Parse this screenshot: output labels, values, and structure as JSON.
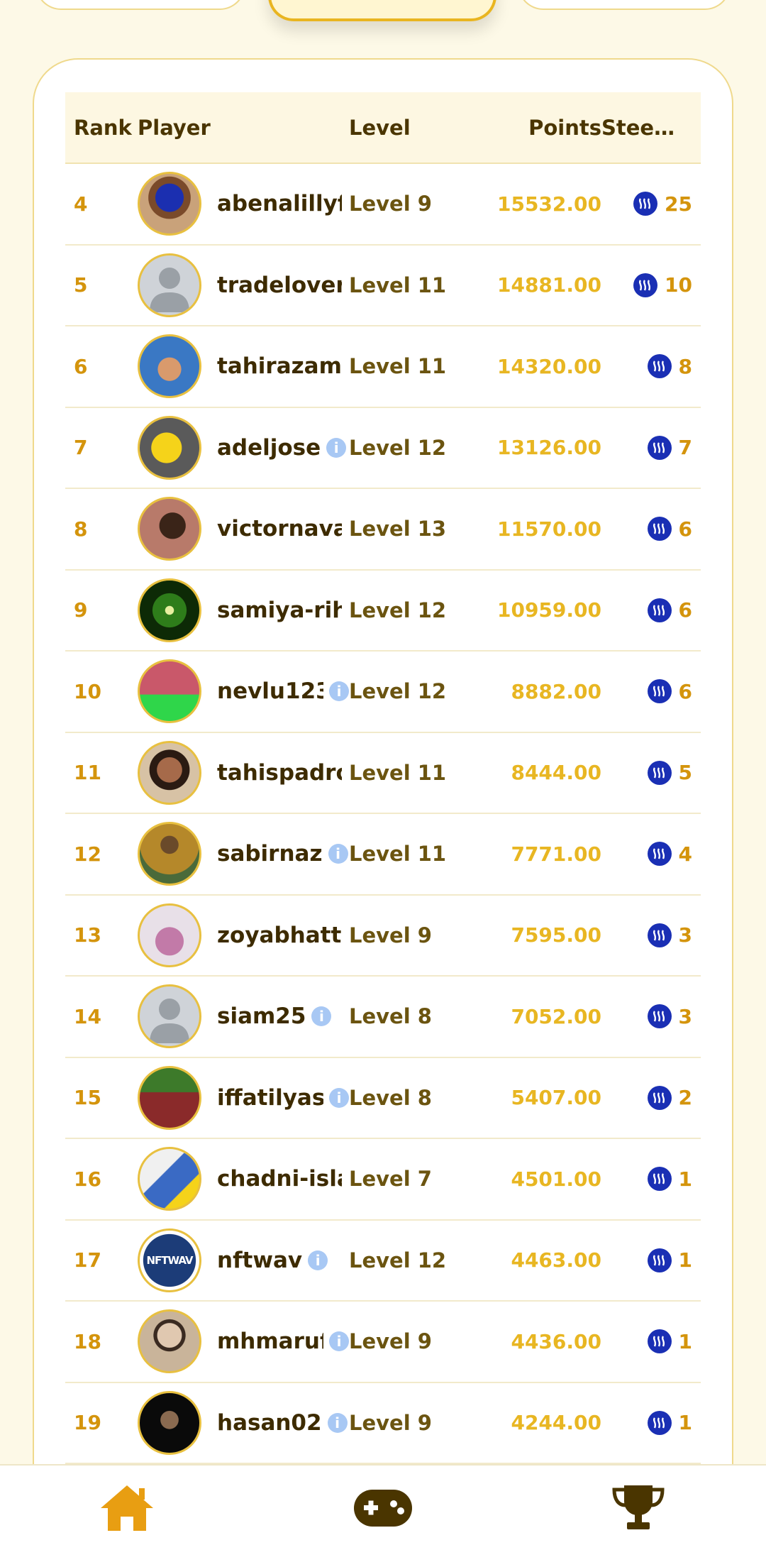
{
  "table": {
    "headers": {
      "rank": "Rank",
      "player": "Player",
      "level": "Level",
      "points": "Points",
      "steem": "Steem R..."
    },
    "rows": [
      {
        "rank": "4",
        "name": "abenalillyf",
        "info": false,
        "level": "Level 9",
        "points": "15532.00",
        "steem": "25",
        "avatar": "photo-blue-dress"
      },
      {
        "rank": "5",
        "name": "tradelover",
        "info": false,
        "level": "Level 11",
        "points": "14881.00",
        "steem": "10",
        "avatar": "default-avatar"
      },
      {
        "rank": "6",
        "name": "tahirazam",
        "info": false,
        "level": "Level 11",
        "points": "14320.00",
        "steem": "8",
        "avatar": "photo-child"
      },
      {
        "rank": "7",
        "name": "adeljose",
        "info": true,
        "level": "Level 12",
        "points": "13126.00",
        "steem": "7",
        "avatar": "cartoon-chick"
      },
      {
        "rank": "8",
        "name": "victornava",
        "info": false,
        "level": "Level 13",
        "points": "11570.00",
        "steem": "6",
        "avatar": "photo-dark"
      },
      {
        "rank": "9",
        "name": "samiya-rih",
        "info": false,
        "level": "Level 12",
        "points": "10959.00",
        "steem": "6",
        "avatar": "green-leaves"
      },
      {
        "rank": "10",
        "name": "nevlu123",
        "info": true,
        "level": "Level 12",
        "points": "8882.00",
        "steem": "6",
        "avatar": "photo-green"
      },
      {
        "rank": "11",
        "name": "tahispadro",
        "info": false,
        "level": "Level 11",
        "points": "8444.00",
        "steem": "5",
        "avatar": "photo-girl"
      },
      {
        "rank": "12",
        "name": "sabirnaz",
        "info": true,
        "level": "Level 11",
        "points": "7771.00",
        "steem": "4",
        "avatar": "photo-man"
      },
      {
        "rank": "13",
        "name": "zoyabhatti",
        "info": false,
        "level": "Level 9",
        "points": "7595.00",
        "steem": "3",
        "avatar": "photo-pink"
      },
      {
        "rank": "14",
        "name": "siam25",
        "info": true,
        "level": "Level 8",
        "points": "7052.00",
        "steem": "3",
        "avatar": "default-avatar"
      },
      {
        "rank": "15",
        "name": "iffatilyas",
        "info": true,
        "level": "Level 8",
        "points": "5407.00",
        "steem": "2",
        "avatar": "photo-outdoor"
      },
      {
        "rank": "16",
        "name": "chadni-isla",
        "info": false,
        "level": "Level 7",
        "points": "4501.00",
        "steem": "1",
        "avatar": "photo-family"
      },
      {
        "rank": "17",
        "name": "nftwav",
        "info": true,
        "level": "Level 12",
        "points": "4463.00",
        "steem": "1",
        "avatar": "nftwav-logo",
        "avatar_text": "NFTWAV"
      },
      {
        "rank": "18",
        "name": "mhmaruf",
        "info": true,
        "level": "Level 9",
        "points": "4436.00",
        "steem": "1",
        "avatar": "photo-man-2"
      },
      {
        "rank": "19",
        "name": "hasan02",
        "info": true,
        "level": "Level 9",
        "points": "4244.00",
        "steem": "1",
        "avatar": "photo-dark-2"
      }
    ]
  },
  "nav": {
    "items": [
      {
        "name": "home",
        "icon": "home-icon",
        "color": "#e89e12"
      },
      {
        "name": "games",
        "icon": "gamepad-icon",
        "color": "#4a3500"
      },
      {
        "name": "leaderboard",
        "icon": "trophy-icon",
        "color": "#4a3500"
      }
    ]
  },
  "colors": {
    "background": "#fdf9e7",
    "accent": "#e8b622",
    "rank": "#d4940c",
    "text_dark": "#3d2b00",
    "steem_blue": "#1a2fb4",
    "info_blue": "#a8c8f4"
  }
}
